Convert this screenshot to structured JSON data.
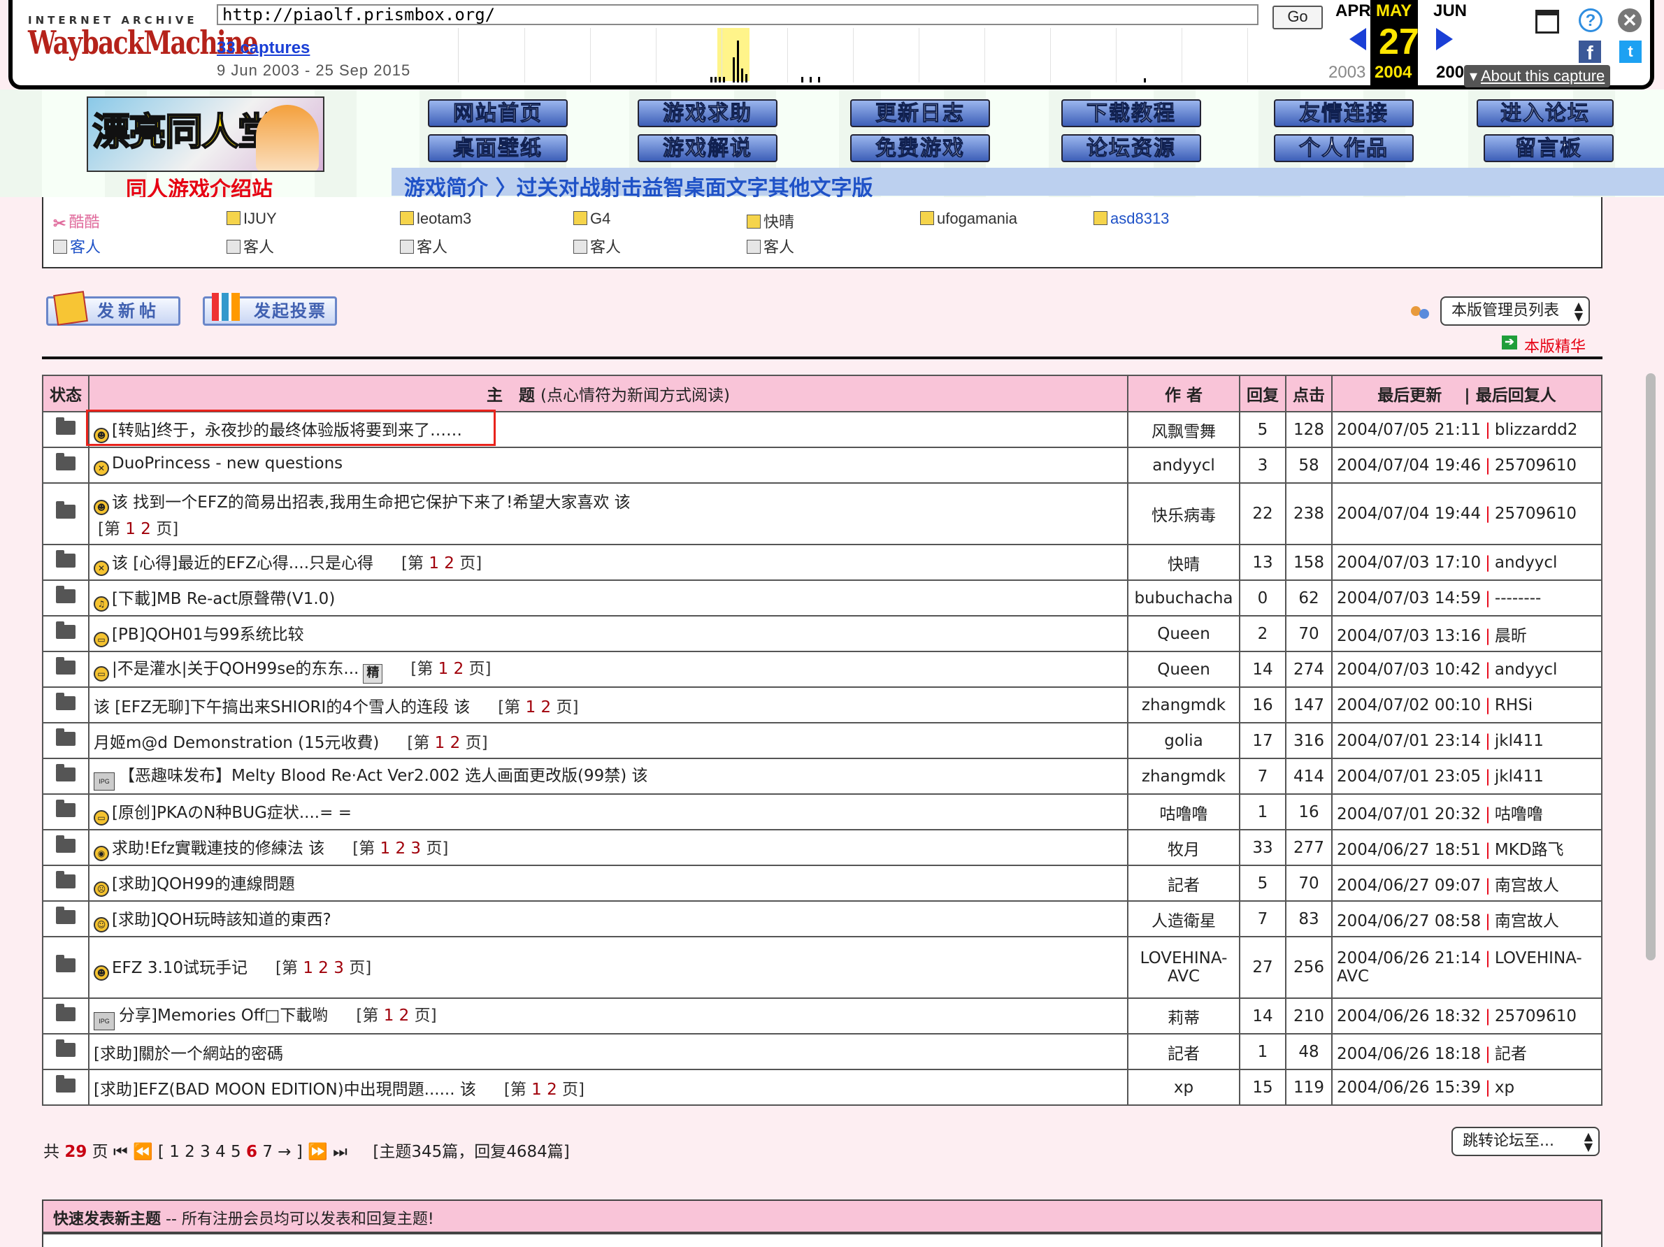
{
  "wayback": {
    "logo_top": "INTERNET ARCHIVE",
    "logo": "WaybackMachine",
    "url": "http://piaolf.prismbox.org/",
    "go": "Go",
    "captures": "33 captures",
    "range": "9 Jun 2003 - 25 Sep 2015",
    "months": {
      "prev": "APR",
      "current": "MAY",
      "next": "JUN"
    },
    "day": "27",
    "years": {
      "prev": "2003",
      "current": "2004",
      "next": "200"
    },
    "about": "About this capture",
    "icons": [
      "calendar-icon",
      "help-icon",
      "close-icon",
      "facebook-icon",
      "twitter-icon"
    ]
  },
  "header": {
    "banner_title": "漂亮同人堂",
    "site_label": "同人游戏介绍站",
    "nav_top": [
      "网站首页",
      "游戏求助",
      "更新日志",
      "下载教程",
      "友情连接",
      "进入论坛"
    ],
    "nav_bottom": [
      "桌面壁纸",
      "游戏解说",
      "免费游戏",
      "论坛资源",
      "个人作品",
      "留言板"
    ],
    "crumb": "游戏简介 〉过关对战射击益智桌面文字其他文字版"
  },
  "online": {
    "row1": [
      "酷酷",
      "IJUY",
      "leotam3",
      "G4",
      "快晴",
      "ufogamania",
      "asd8313"
    ],
    "row2": [
      "客人",
      "客人",
      "客人",
      "客人",
      "客人"
    ]
  },
  "actions": {
    "new_post": "发新帖",
    "new_poll": "发起投票",
    "moderator_list": "本版管理员列表",
    "digest": "本版精华"
  },
  "table": {
    "headers": {
      "status": "状态",
      "topic": "主　题",
      "topic_note": "(点心情符为新闻方式阅读)",
      "author": "作 者",
      "replies": "回复",
      "clicks": "点击",
      "last_update": "最后更新",
      "last_replier": "| 最后回复人"
    },
    "rows": [
      {
        "title": "[转贴]终于，永夜抄的最终体验版将要到来了……",
        "author": "风飘雪舞",
        "replies": "5",
        "clicks": "128",
        "date": "2004/07/05 21:11",
        "last": "blizzardd2"
      },
      {
        "title": "DuoPrincess - new questions",
        "author": "andyycl",
        "replies": "3",
        "clicks": "58",
        "date": "2004/07/04 19:46",
        "last": "25709610"
      },
      {
        "title": "该  找到一个EFZ的简易出招表,我用生命把它保护下来了!希望大家喜欢 该",
        "pages_label": "[第",
        "pages": "1 2",
        "pages_end": "页]",
        "author": "快乐病毒",
        "replies": "22",
        "clicks": "238",
        "date": "2004/07/04 19:44",
        "last": "25709610"
      },
      {
        "title": "该 [心得]最近的EFZ心得....只是心得",
        "pages_label": "[第",
        "pages": "1 2",
        "pages_end": "页]",
        "author": "快晴",
        "replies": "13",
        "clicks": "158",
        "date": "2004/07/03 17:10",
        "last": "andyycl"
      },
      {
        "title": "[下載]MB Re-act原聲帶(V1.0)",
        "author": "bubuchacha",
        "replies": "0",
        "clicks": "62",
        "date": "2004/07/03 14:59",
        "last": "--------"
      },
      {
        "title": "[PB]QOH01与99系统比较",
        "author": "Queen",
        "replies": "2",
        "clicks": "70",
        "date": "2004/07/03 13:16",
        "last": "晨昕"
      },
      {
        "title": "|不是灌水|关于QOH99se的东东...",
        "tag": "精",
        "pages_label": "[第",
        "pages": "1 2",
        "pages_end": "页]",
        "author": "Queen",
        "replies": "14",
        "clicks": "274",
        "date": "2004/07/03 10:42",
        "last": "andyycl"
      },
      {
        "title": "该 [EFZ无聊]下午搞出来SHIORI的4个雪人的连段 该",
        "pages_label": "[第",
        "pages": "1 2",
        "pages_end": "页]",
        "author": "zhangmdk",
        "replies": "16",
        "clicks": "147",
        "date": "2004/07/02 00:10",
        "last": "RHSi"
      },
      {
        "title": "月姬m@d Demonstration (15元收費)",
        "pages_label": "[第",
        "pages": "1 2",
        "pages_end": "页]",
        "author": "golia",
        "replies": "17",
        "clicks": "316",
        "date": "2004/07/01 23:14",
        "last": "jkl411"
      },
      {
        "title": "【恶趣味发布】Melty Blood Re·Act Ver2.002 选人画面更改版(99禁) 该",
        "author": "zhangmdk",
        "replies": "7",
        "clicks": "414",
        "date": "2004/07/01 23:05",
        "last": "jkl411"
      },
      {
        "title": "[原创]PKAのN种BUG症状....= =",
        "author": "咕噜噜",
        "replies": "1",
        "clicks": "16",
        "date": "2004/07/01 20:32",
        "last": "咕噜噜"
      },
      {
        "title": "求助!Efz實戰連技的修練法 该",
        "pages_label": "[第",
        "pages": "1 2 3",
        "pages_end": "页]",
        "author": "牧月",
        "replies": "33",
        "clicks": "277",
        "date": "2004/06/27 18:51",
        "last": "MKD路飞"
      },
      {
        "title": "[求助]QOH99的連線問題",
        "author": "記者",
        "replies": "5",
        "clicks": "70",
        "date": "2004/06/27 09:07",
        "last": "南宫故人"
      },
      {
        "title": "[求助]QOH玩時該知道的東西?",
        "author": "人造衛星",
        "replies": "7",
        "clicks": "83",
        "date": "2004/06/27 08:58",
        "last": "南宫故人"
      },
      {
        "title": "EFZ 3.10试玩手记",
        "pages_label": "[第",
        "pages": "1 2 3",
        "pages_end": "页]",
        "author": "LOVEHINA-AVC",
        "replies": "27",
        "clicks": "256",
        "date": "2004/06/26 21:14",
        "last": "LOVEHINA-AVC"
      },
      {
        "title": "分享]Memories Off□下載喲",
        "pages_label": "[第",
        "pages": "1 2",
        "pages_end": "页]",
        "author": "莉蒂",
        "replies": "14",
        "clicks": "210",
        "date": "2004/06/26 18:32",
        "last": "25709610"
      },
      {
        "title": "[求助]關於一个網站的密碼",
        "author": "記者",
        "replies": "1",
        "clicks": "48",
        "date": "2004/06/26 18:18",
        "last": "記者"
      },
      {
        "title": "[求助]EFZ(BAD MOON EDITION)中出現問題...... 该",
        "pages_label": "[第",
        "pages": "1 2",
        "pages_end": "页]",
        "author": "xp",
        "replies": "15",
        "clicks": "119",
        "date": "2004/06/26 15:39",
        "last": "xp"
      }
    ]
  },
  "pagination": {
    "total_prefix": "共",
    "total_pages": "29",
    "total_suffix": "页",
    "first": "⏮",
    "prev": "⏪",
    "pages": [
      "1",
      "2",
      "3",
      "4",
      "5"
    ],
    "current": "6",
    "next_page": "7",
    "arrow": "→",
    "next": "⏩",
    "last": "⏭",
    "summary": "[主题345篇，回复4684篇]",
    "jump": "跳转论坛至..."
  },
  "quick_post": {
    "title": "快速发表新主题",
    "note": " -- 所有注册会员均可以发表和回复主题!"
  },
  "colors": {
    "accent_red": "#e60012",
    "table_header": "#f9c4d8",
    "page_bg": "#fdeef2",
    "link_blue": "#1f52c7",
    "highlight_box": "#e8231c"
  }
}
